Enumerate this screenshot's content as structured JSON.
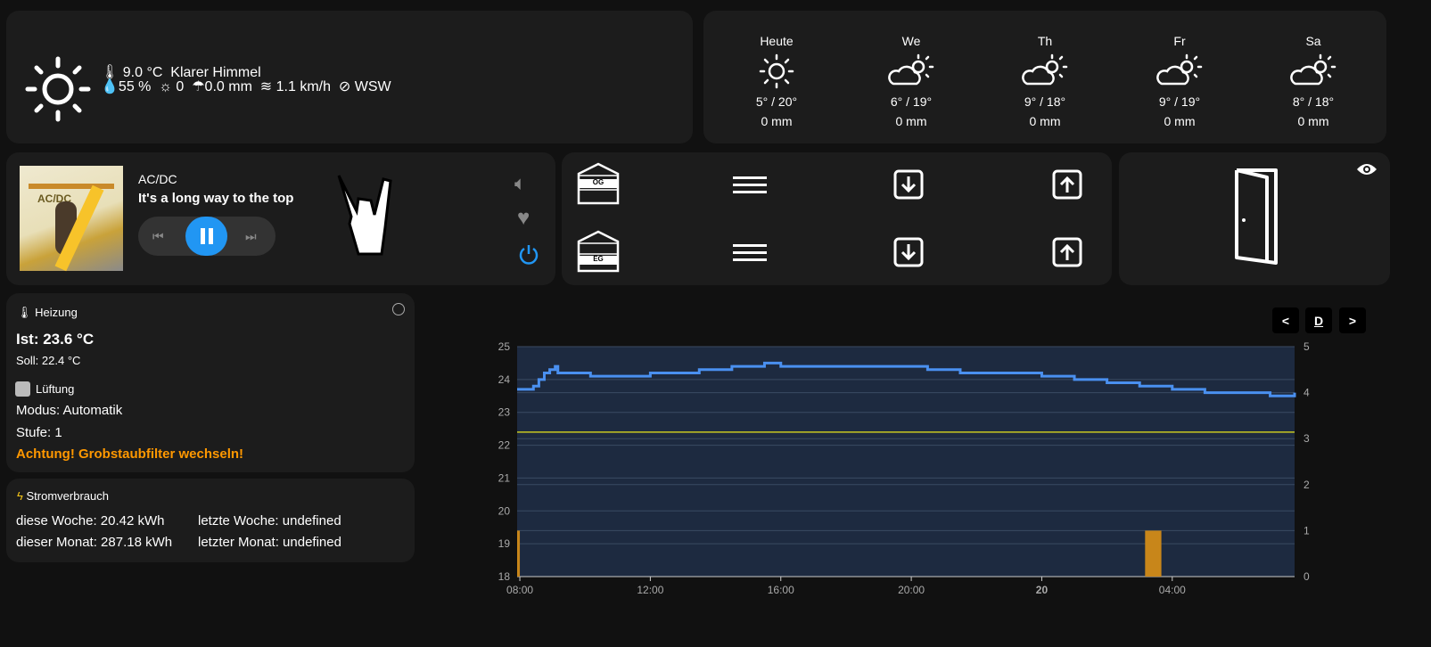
{
  "weather": {
    "temperature": "9.0 °C",
    "condition": "Klarer Himmel",
    "humidity": "55 %",
    "uv": "0",
    "precipitation": "0.0 mm",
    "wind_speed": "1.1 km/h",
    "wind_dir": "WSW",
    "icon": "sun-icon"
  },
  "forecast": [
    {
      "day": "Heute",
      "temps": "5° / 20°",
      "rain": "0 mm",
      "icon": "sunny"
    },
    {
      "day": "We",
      "temps": "6° / 19°",
      "rain": "0 mm",
      "icon": "partly-cloudy"
    },
    {
      "day": "Th",
      "temps": "9° / 18°",
      "rain": "0 mm",
      "icon": "partly-cloudy"
    },
    {
      "day": "Fr",
      "temps": "9° / 19°",
      "rain": "0 mm",
      "icon": "partly-cloudy"
    },
    {
      "day": "Sa",
      "temps": "8° / 18°",
      "rain": "0 mm",
      "icon": "partly-cloudy"
    }
  ],
  "media": {
    "artist": "AC/DC",
    "title": "It's a long way to the top",
    "album_art_text": "AC/DC",
    "state": "playing",
    "accent": "#2196f3"
  },
  "shutters": [
    {
      "floor": "OG"
    },
    {
      "floor": "EG"
    }
  ],
  "heating": {
    "title": "Heizung",
    "current": "Ist: 23.6 °C",
    "target": "Soll: 22.4 °C"
  },
  "ventilation": {
    "title": "Lüftung",
    "mode": "Modus: Automatik",
    "level": "Stufe: 1",
    "warning": "Achtung! Grobstaubfilter wechseln!",
    "warning_color": "#ff9800"
  },
  "power": {
    "title": "Stromverbrauch",
    "this_week": "diese Woche: 20.42 kWh",
    "last_week": "letzte Woche: undefined",
    "this_month": "dieser Monat: 287.18 kWh",
    "last_month": "letzter Monat: undefined"
  },
  "chart_controls": {
    "prev": "<",
    "period": "D",
    "next": ">"
  },
  "chart_data": {
    "type": "line",
    "x_ticks": [
      "08:00",
      "12:00",
      "16:00",
      "20:00",
      "20",
      "04:00"
    ],
    "y_left": {
      "range": [
        18,
        25
      ],
      "ticks": [
        "18",
        "19",
        "20",
        "21",
        "22",
        "23",
        "24",
        "25"
      ]
    },
    "y_right": {
      "range": [
        0,
        5
      ],
      "ticks": [
        "0",
        "1",
        "2",
        "3",
        "4",
        "5"
      ]
    },
    "grid": true,
    "series": [
      {
        "type": "step",
        "color": "#4a90f0",
        "axis": "left",
        "points": [
          [
            "19 07:55",
            23.7
          ],
          [
            "19 08:25",
            23.8
          ],
          [
            "19 08:35",
            24.0
          ],
          [
            "19 08:45",
            24.2
          ],
          [
            "19 08:55",
            24.3
          ],
          [
            "19 09:05",
            24.4
          ],
          [
            "19 09:10",
            24.2
          ],
          [
            "19 10:10",
            24.1
          ],
          [
            "19 11:10",
            24.1
          ],
          [
            "19 12:00",
            24.2
          ],
          [
            "19 13:00",
            24.2
          ],
          [
            "19 13:30",
            24.3
          ],
          [
            "19 14:30",
            24.4
          ],
          [
            "19 15:30",
            24.5
          ],
          [
            "19 16:00",
            24.4
          ],
          [
            "19 17:00",
            24.4
          ],
          [
            "19 18:00",
            24.4
          ],
          [
            "19 19:00",
            24.4
          ],
          [
            "19 20:00",
            24.4
          ],
          [
            "19 20:30",
            24.3
          ],
          [
            "19 21:30",
            24.2
          ],
          [
            "19 23:00",
            24.2
          ],
          [
            "20 00:00",
            24.1
          ],
          [
            "20 01:00",
            24.0
          ],
          [
            "20 02:00",
            23.9
          ],
          [
            "20 03:00",
            23.8
          ],
          [
            "20 04:00",
            23.7
          ],
          [
            "20 05:00",
            23.6
          ],
          [
            "20 06:00",
            23.6
          ],
          [
            "20 07:00",
            23.5
          ],
          [
            "20 07:45",
            23.6
          ]
        ]
      },
      {
        "type": "line",
        "color": "#c8c820",
        "axis": "left",
        "value": 22.4
      },
      {
        "type": "bar",
        "color": "#c8861a",
        "axis": "right",
        "bars": [
          [
            "19 07:55",
            "19 08:00",
            1
          ],
          [
            "20 03:10",
            "20 03:40",
            1
          ]
        ]
      }
    ],
    "x_range": [
      "19 07:55",
      "20 07:45"
    ]
  }
}
